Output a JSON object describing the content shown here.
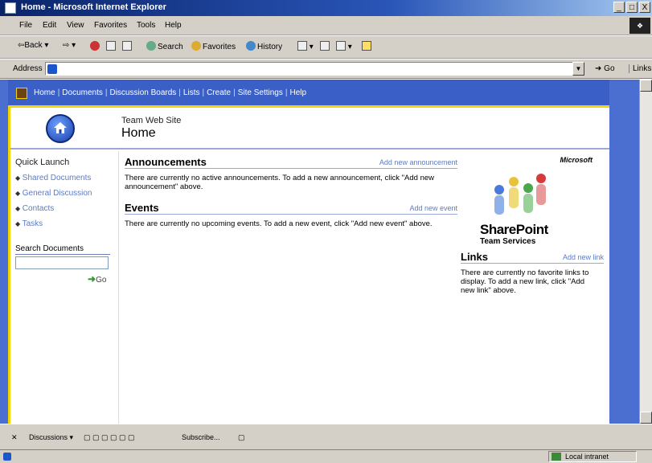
{
  "window": {
    "title": "Home - Microsoft Internet Explorer",
    "controls": [
      "_",
      "□",
      "X"
    ]
  },
  "menubar": [
    "File",
    "Edit",
    "View",
    "Favorites",
    "Tools",
    "Help"
  ],
  "toolbar": {
    "back": "Back",
    "search": "Search",
    "favorites": "Favorites",
    "history": "History"
  },
  "addressbar": {
    "label": "Address",
    "url": "",
    "go": "Go",
    "links": "Links"
  },
  "topnav": [
    "Home",
    "Documents",
    "Discussion Boards",
    "Lists",
    "Create",
    "Site Settings",
    "Help"
  ],
  "header": {
    "site_name": "Team Web Site",
    "page_title": "Home"
  },
  "quick_launch": {
    "heading": "Quick Launch",
    "items": [
      "Shared Documents",
      "General Discussion",
      "Contacts",
      "Tasks"
    ]
  },
  "search": {
    "heading": "Search Documents",
    "value": "",
    "go": "Go"
  },
  "announcements": {
    "title": "Announcements",
    "link": "Add new announcement",
    "body": "There are currently no active announcements. To add a new announcement, click \"Add new announcement\" above."
  },
  "events": {
    "title": "Events",
    "link": "Add new event",
    "body": "There are currently no upcoming events. To add a new event, click \"Add new event\" above."
  },
  "branding": {
    "vendor": "Microsoft",
    "product": "SharePoint",
    "product_sub": "Team Services"
  },
  "links_section": {
    "title": "Links",
    "link": "Add new link",
    "body": "There are currently no favorite links to display. To add a new link, click \"Add new link\" above."
  },
  "discussions_bar": {
    "discussions": "Discussions",
    "subscribe": "Subscribe..."
  },
  "statusbar": {
    "zone": "Local intranet"
  }
}
